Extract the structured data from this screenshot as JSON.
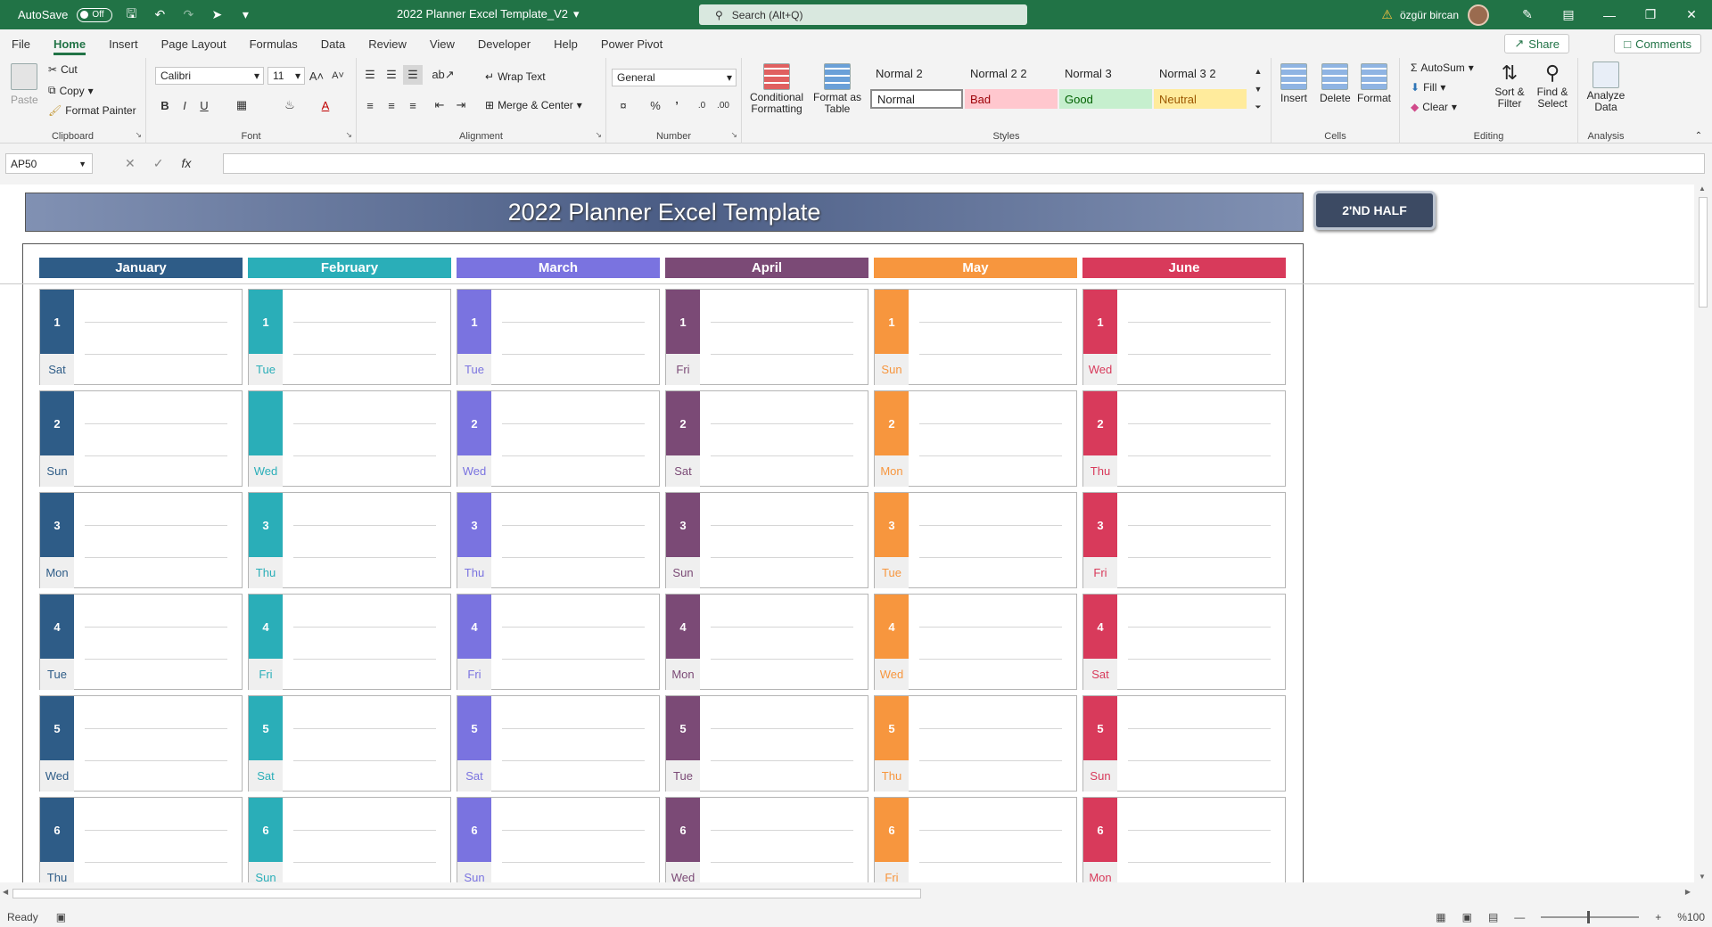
{
  "titlebar": {
    "autosave_label": "AutoSave",
    "autosave_state": "Off",
    "doc_title": "2022 Planner Excel Template_V2",
    "search_placeholder": "Search (Alt+Q)",
    "username": "özgür bircan"
  },
  "menu": {
    "tabs": [
      "File",
      "Home",
      "Insert",
      "Page Layout",
      "Formulas",
      "Data",
      "Review",
      "View",
      "Developer",
      "Help",
      "Power Pivot"
    ],
    "active": "Home",
    "share_label": "Share",
    "comments_label": "Comments"
  },
  "ribbon": {
    "clipboard": {
      "label": "Clipboard",
      "paste": "Paste",
      "cut": "Cut",
      "copy": "Copy",
      "format_painter": "Format Painter"
    },
    "font": {
      "label": "Font",
      "family": "Calibri",
      "size": "11"
    },
    "alignment": {
      "label": "Alignment",
      "wrap_text": "Wrap Text",
      "merge_center": "Merge & Center"
    },
    "number": {
      "label": "Number",
      "format": "General"
    },
    "styles": {
      "label": "Styles",
      "conditional": "Conditional Formatting",
      "format_table": "Format as Table",
      "items": [
        "Normal 2",
        "Normal 2 2",
        "Normal 3",
        "Normal 3 2",
        "Normal",
        "Bad",
        "Good",
        "Neutral"
      ]
    },
    "cells": {
      "label": "Cells",
      "insert": "Insert",
      "delete": "Delete",
      "format": "Format"
    },
    "editing": {
      "label": "Editing",
      "autosum": "AutoSum",
      "fill": "Fill",
      "clear": "Clear",
      "sort_filter": "Sort & Filter",
      "find_select": "Find & Select"
    },
    "analysis": {
      "label": "Analysis",
      "analyze": "Analyze Data"
    }
  },
  "formula_bar": {
    "name_box": "AP50",
    "formula": ""
  },
  "sheet": {
    "title": "2022 Planner Excel Template",
    "half_button": "2'ND HALF",
    "months": [
      {
        "name": "January",
        "color": "#2e5c87",
        "days": [
          {
            "n": "1",
            "d": "Sat"
          },
          {
            "n": "2",
            "d": "Sun"
          },
          {
            "n": "3",
            "d": "Mon"
          },
          {
            "n": "4",
            "d": "Tue"
          },
          {
            "n": "5",
            "d": "Wed"
          },
          {
            "n": "6",
            "d": "Thu"
          }
        ]
      },
      {
        "name": "February",
        "color": "#2aaeb8",
        "days": [
          {
            "n": "1",
            "d": "Tue"
          },
          {
            "n": "",
            "d": "Wed"
          },
          {
            "n": "3",
            "d": "Thu"
          },
          {
            "n": "4",
            "d": "Fri"
          },
          {
            "n": "5",
            "d": "Sat"
          },
          {
            "n": "6",
            "d": "Sun"
          }
        ]
      },
      {
        "name": "March",
        "color": "#7a73e0",
        "days": [
          {
            "n": "1",
            "d": "Tue"
          },
          {
            "n": "2",
            "d": "Wed"
          },
          {
            "n": "3",
            "d": "Thu"
          },
          {
            "n": "4",
            "d": "Fri"
          },
          {
            "n": "5",
            "d": "Sat"
          },
          {
            "n": "6",
            "d": "Sun"
          }
        ]
      },
      {
        "name": "April",
        "color": "#7b4a76",
        "days": [
          {
            "n": "1",
            "d": "Fri"
          },
          {
            "n": "2",
            "d": "Sat"
          },
          {
            "n": "3",
            "d": "Sun"
          },
          {
            "n": "4",
            "d": "Mon"
          },
          {
            "n": "5",
            "d": "Tue"
          },
          {
            "n": "6",
            "d": "Wed"
          }
        ]
      },
      {
        "name": "May",
        "color": "#f7963e",
        "days": [
          {
            "n": "1",
            "d": "Sun"
          },
          {
            "n": "2",
            "d": "Mon"
          },
          {
            "n": "3",
            "d": "Tue"
          },
          {
            "n": "4",
            "d": "Wed"
          },
          {
            "n": "5",
            "d": "Thu"
          },
          {
            "n": "6",
            "d": "Fri"
          }
        ]
      },
      {
        "name": "June",
        "color": "#d83a5b",
        "days": [
          {
            "n": "1",
            "d": "Wed"
          },
          {
            "n": "2",
            "d": "Thu"
          },
          {
            "n": "3",
            "d": "Fri"
          },
          {
            "n": "4",
            "d": "Sat"
          },
          {
            "n": "5",
            "d": "Sun"
          },
          {
            "n": "6",
            "d": "Mon"
          }
        ]
      }
    ]
  },
  "status": {
    "ready": "Ready",
    "zoom": "%100"
  }
}
